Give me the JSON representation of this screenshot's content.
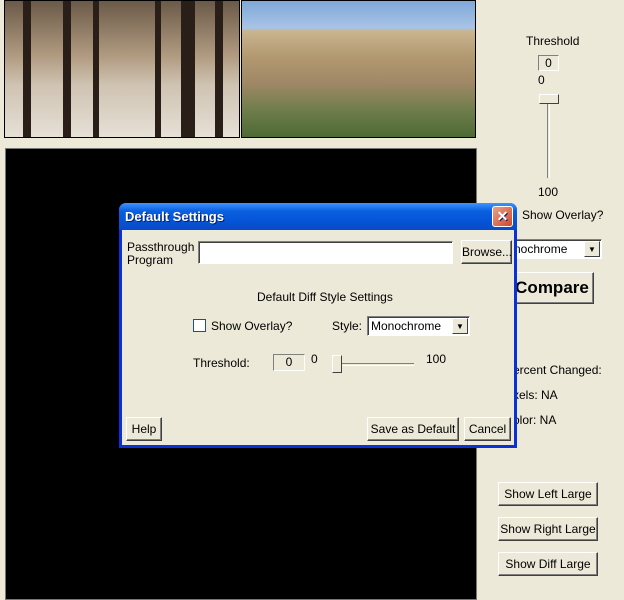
{
  "images": {
    "left": "Alhambra courtyard photo",
    "right": "Acropolis photo"
  },
  "side": {
    "threshold_label": "Threshold",
    "threshold_value": "0",
    "slider_min": "0",
    "slider_max": "100",
    "threshold_level": 0,
    "show_overlay": "Show Overlay?",
    "style_value": "nochrome",
    "compare": "Compare",
    "percent_changed": "ercent Changed:",
    "pixels": "xels: NA",
    "color": "olor: NA",
    "show_left": "Show Left Large",
    "show_right": "Show Right Large",
    "show_diff": "Show Diff Large"
  },
  "dialog": {
    "title": "Default Settings",
    "close": "✕",
    "passthrough_label_1": "Passthrough",
    "passthrough_label_2": "Program",
    "passthrough_value": "",
    "browse": "Browse...",
    "section": "Default Diff Style Settings",
    "show_overlay": "Show Overlay?",
    "style_label": "Style:",
    "style_value": "Monochrome",
    "threshold_label": "Threshold:",
    "threshold_value": "0",
    "slider_min": "0",
    "slider_max": "100",
    "threshold_level": 0,
    "help": "Help",
    "save_default": "Save as Default",
    "cancel": "Cancel"
  }
}
